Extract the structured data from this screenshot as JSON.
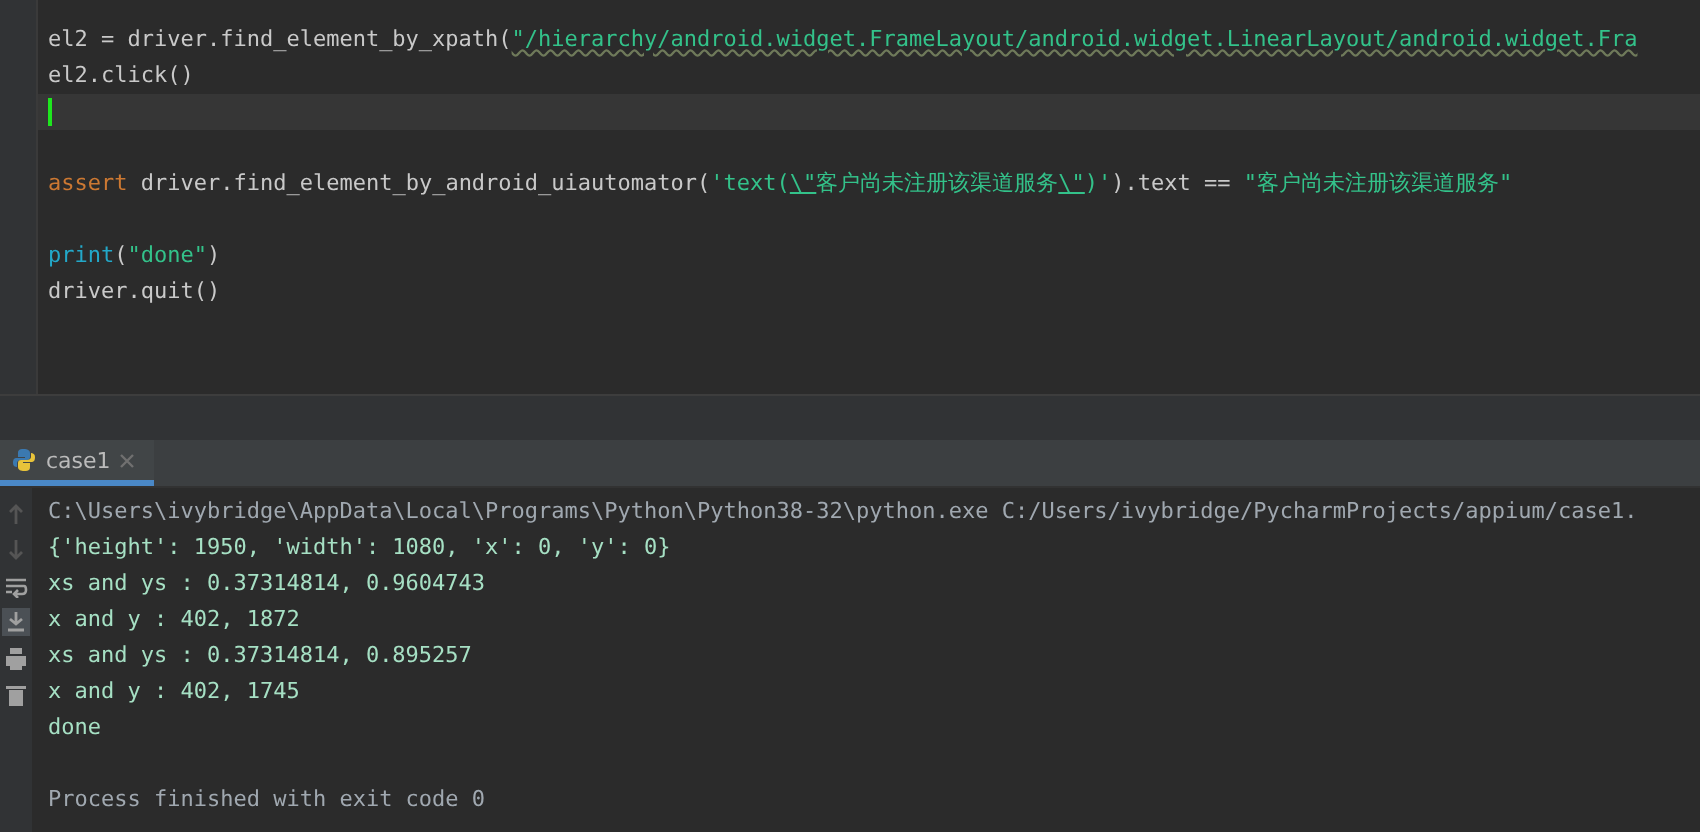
{
  "editor": {
    "lines": [
      {
        "kind": "code",
        "tokens": [
          {
            "kind": "plain",
            "text": "el2 = driver.find_element_by_xpath("
          },
          {
            "kind": "string_warned",
            "text": "\"/hierarchy/android.widget.FrameLayout/android.widget.LinearLayout/android.widget.Fra"
          }
        ]
      },
      {
        "kind": "code",
        "tokens": [
          {
            "kind": "plain",
            "text": "el2.click()"
          }
        ]
      },
      {
        "kind": "current"
      },
      {
        "kind": "blank"
      },
      {
        "kind": "code",
        "tokens": [
          {
            "kind": "keyword",
            "text": "assert"
          },
          {
            "kind": "plain",
            "text": " driver.find_element_by_android_uiautomator("
          },
          {
            "kind": "string",
            "text": "'text("
          },
          {
            "kind": "escape",
            "text": "\\\""
          },
          {
            "kind": "string",
            "text": "客户尚未注册该渠道服务"
          },
          {
            "kind": "escape",
            "text": "\\\""
          },
          {
            "kind": "string",
            "text": ")'"
          },
          {
            "kind": "plain",
            "text": ").text == "
          },
          {
            "kind": "string",
            "text": "\"客户尚未注册该渠道服务\""
          }
        ]
      },
      {
        "kind": "blank"
      },
      {
        "kind": "code",
        "tokens": [
          {
            "kind": "builtin",
            "text": "print"
          },
          {
            "kind": "plain",
            "text": "("
          },
          {
            "kind": "string",
            "text": "\"done\""
          },
          {
            "kind": "plain",
            "text": ")"
          }
        ]
      },
      {
        "kind": "code",
        "tokens": [
          {
            "kind": "plain",
            "text": "driver.quit()"
          }
        ]
      }
    ]
  },
  "run_panel": {
    "tabs": [
      {
        "label": "case1",
        "selected": true
      }
    ],
    "tools": [
      {
        "kind": "up",
        "disabled": true,
        "on": false
      },
      {
        "kind": "down",
        "disabled": true,
        "on": false
      },
      {
        "kind": "wrap",
        "disabled": false,
        "on": false
      },
      {
        "kind": "scroll_end",
        "disabled": false,
        "on": true
      },
      {
        "kind": "print",
        "disabled": false,
        "on": false
      },
      {
        "kind": "trash",
        "disabled": false,
        "on": false
      }
    ],
    "lines": [
      {
        "kind": "system",
        "text": "C:\\Users\\ivybridge\\AppData\\Local\\Programs\\Python\\Python38-32\\python.exe C:/Users/ivybridge/PycharmProjects/appium/case1."
      },
      {
        "kind": "output",
        "text": "{'height': 1950, 'width': 1080, 'x': 0, 'y': 0}"
      },
      {
        "kind": "output",
        "text": "xs and ys : 0.37314814, 0.9604743"
      },
      {
        "kind": "output",
        "text": "x and y : 402, 1872"
      },
      {
        "kind": "output",
        "text": "xs and ys : 0.37314814, 0.895257"
      },
      {
        "kind": "output",
        "text": "x and y : 402, 1745"
      },
      {
        "kind": "output",
        "text": "done"
      },
      {
        "kind": "blank"
      },
      {
        "kind": "system",
        "text": "Process finished with exit code 0"
      }
    ]
  }
}
